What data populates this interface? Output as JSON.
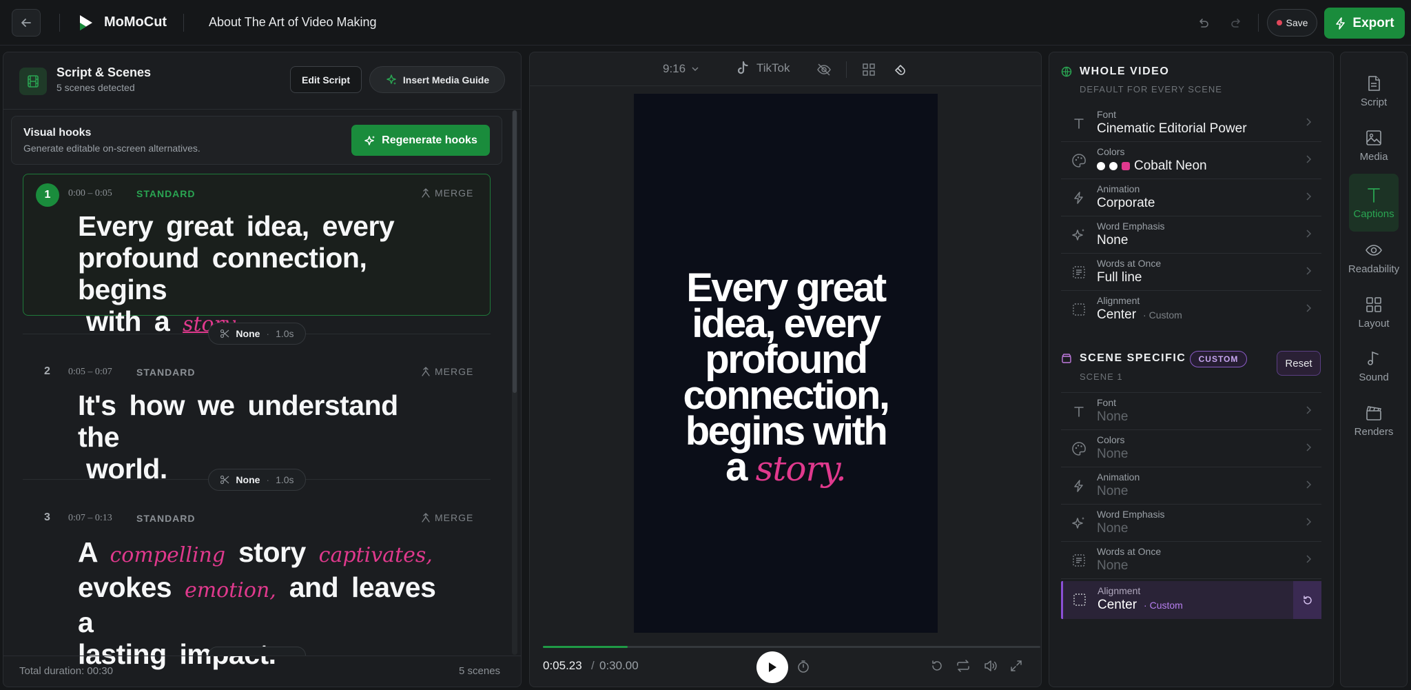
{
  "topbar": {
    "brand": "MoMoCut",
    "doc_title": "About The Art of Video Making",
    "save_label": "Save",
    "export_label": "Export",
    "accent_color": "#1a8c3c"
  },
  "scenes_panel": {
    "title": "Script & Scenes",
    "subtitle": "5 scenes detected",
    "edit_script_label": "Edit Script",
    "insert_media_label": "Insert Media Guide",
    "hooks": {
      "title": "Visual hooks",
      "subtitle": "Generate editable on-screen alternatives.",
      "regenerate_label": "Regenerate hooks"
    },
    "scenes": [
      {
        "num": "1",
        "time": "0:00 – 0:05",
        "tag": "STANDARD",
        "merge": "MERGE",
        "line1": "Every great idea, every",
        "line2": "profound connection, begins",
        "line3a": "with a",
        "line3b": "story."
      },
      {
        "num": "2",
        "time": "0:05 – 0:07",
        "tag": "STANDARD",
        "merge": "MERGE",
        "line1": "It's how we understand the",
        "line2": "world."
      },
      {
        "num": "3",
        "time": "0:07 – 0:13",
        "tag": "STANDARD",
        "merge": "MERGE",
        "w1": "A",
        "w2": "compelling",
        "w3": "story",
        "w4": "captivates,",
        "w5": "evokes",
        "w6": "emotion,",
        "w7": "and leaves a",
        "w8": "lasting impact."
      }
    ],
    "transitions": [
      {
        "name": "None",
        "duration": "1.0s"
      },
      {
        "name": "None",
        "duration": "1.0s"
      }
    ],
    "footer_total": "Total duration: 00:30",
    "footer_count": "5 scenes"
  },
  "preview": {
    "ratio": "9:16",
    "platform": "TikTok",
    "caption_line1": "Every great",
    "caption_line2": "idea, every",
    "caption_line3": "profound",
    "caption_line4": "connection,",
    "caption_line5": "begins with",
    "caption_line6a": "a",
    "caption_line6b": "story.",
    "progress_fraction": 0.17,
    "time_current": "0:05.23",
    "time_separator": "/",
    "time_total": "0:30.00"
  },
  "whole_video": {
    "title": "WHOLE VIDEO",
    "subtitle": "DEFAULT FOR EVERY SCENE",
    "rows": [
      {
        "label": "Font",
        "value": "Cinematic Editorial Power",
        "icon": "font-icon"
      },
      {
        "label": "Colors",
        "value": "Cobalt Neon",
        "icon": "palette-icon"
      },
      {
        "label": "Animation",
        "value": "Corporate",
        "icon": "bolt-icon"
      },
      {
        "label": "Word Emphasis",
        "value": "None",
        "icon": "sparkle-icon"
      },
      {
        "label": "Words at Once",
        "value": "Full line",
        "icon": "words-icon"
      },
      {
        "label": "Alignment",
        "value": "Center",
        "note": "· Custom",
        "icon": "align-icon"
      }
    ],
    "swatch_colors": [
      "#ffffff",
      "#ffffff",
      "#e0398d"
    ]
  },
  "scene_specific": {
    "title": "SCENE SPECIFIC",
    "badge": "CUSTOM",
    "subtitle": "SCENE 1",
    "reset_label": "Reset",
    "rows": [
      {
        "label": "Font",
        "value": "None"
      },
      {
        "label": "Colors",
        "value": "None"
      },
      {
        "label": "Animation",
        "value": "None"
      },
      {
        "label": "Word Emphasis",
        "value": "None"
      },
      {
        "label": "Words at Once",
        "value": "None"
      },
      {
        "label": "Alignment",
        "value": "Center",
        "note": "· Custom"
      }
    ]
  },
  "rail": [
    {
      "label": "Script",
      "icon": "script-icon"
    },
    {
      "label": "Media",
      "icon": "media-icon"
    },
    {
      "label": "Captions",
      "icon": "captions-icon",
      "active": true
    },
    {
      "label": "Readability",
      "icon": "eye-icon"
    },
    {
      "label": "Layout",
      "icon": "layout-icon"
    },
    {
      "label": "Sound",
      "icon": "music-icon"
    },
    {
      "label": "Renders",
      "icon": "clapper-icon"
    }
  ]
}
